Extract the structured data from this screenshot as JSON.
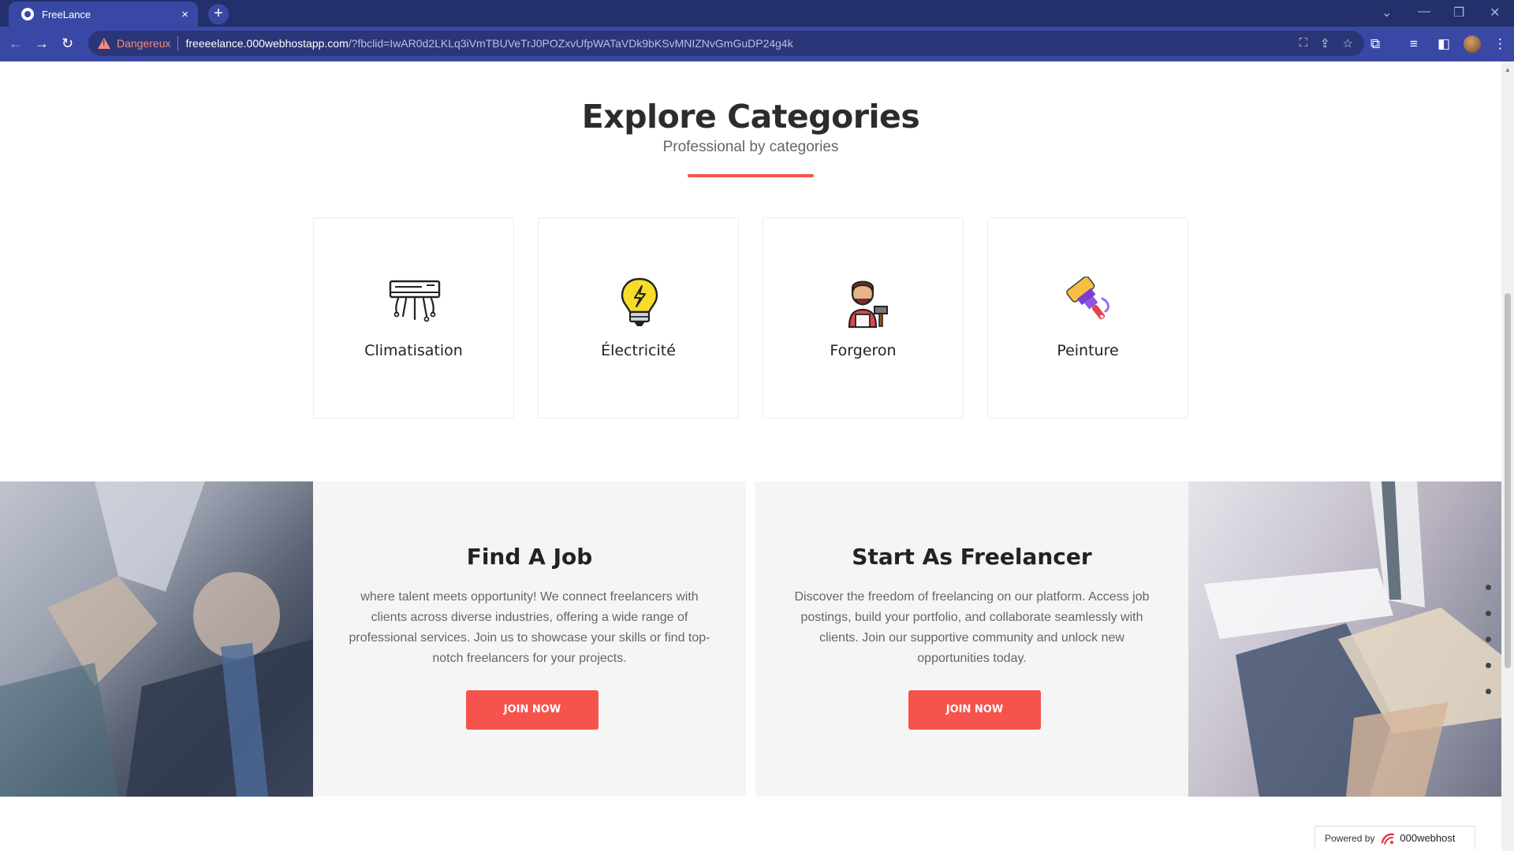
{
  "browser": {
    "tab_title": "FreeLance",
    "tab_close": "×",
    "new_tab": "+",
    "security_label": "Dangereux",
    "url_host": "freeeelance.000webhostapp.com",
    "url_rest": "/?fbclid=IwAR0d2LKLq3iVmTBUVeTrJ0POZxvUfpWATaVDk9bKSvMNIZNvGmGuDP24g4k"
  },
  "categories": {
    "title": "Explore Categories",
    "subtitle": "Professional by categories",
    "items": [
      {
        "label": "Climatisation",
        "icon": "air-conditioner-icon"
      },
      {
        "label": "Électricité",
        "icon": "lightbulb-icon"
      },
      {
        "label": "Forgeron",
        "icon": "blacksmith-icon"
      },
      {
        "label": "Peinture",
        "icon": "paint-roller-icon"
      }
    ]
  },
  "find_job": {
    "title": "Find A Job",
    "text": "where talent meets opportunity! We connect freelancers with clients across diverse industries, offering a wide range of professional services. Join us to showcase your skills or find top-notch freelancers for your projects.",
    "button": "JOIN NOW"
  },
  "freelancer": {
    "title": "Start As Freelancer",
    "text": "Discover the freedom of freelancing on our platform. Access job postings, build your portfolio, and collaborate seamlessly with clients. Join our supportive community and unlock new opportunities today.",
    "button": "JOIN NOW"
  },
  "footer_badge": {
    "powered_by": "Powered by",
    "brand": "000webhost"
  },
  "colors": {
    "accent": "#f4544c",
    "chrome": "#3a48a5"
  }
}
